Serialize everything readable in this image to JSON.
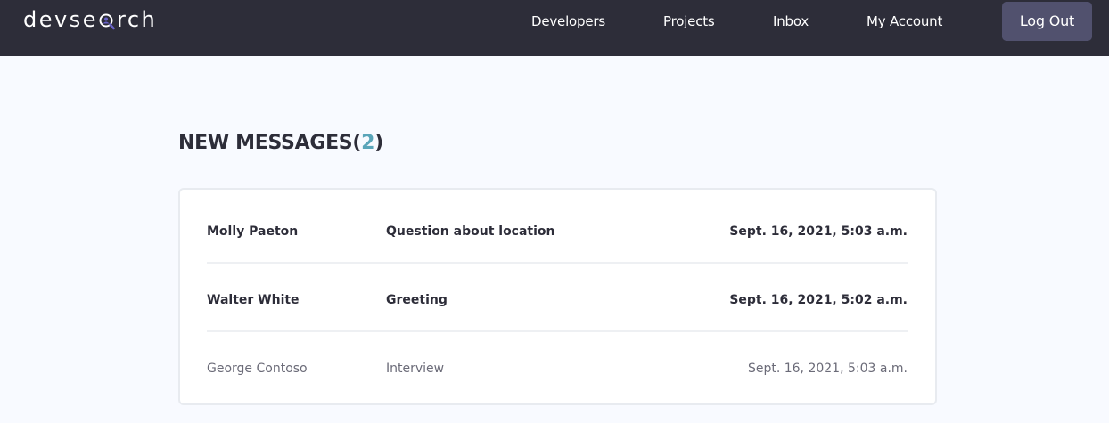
{
  "app": {
    "logo_prefix": "devse",
    "logo_suffix": "rch",
    "logo_icon": "magnifier-person-icon"
  },
  "nav": {
    "developers": "Developers",
    "projects": "Projects",
    "inbox": "Inbox",
    "account": "My Account",
    "logout": "Log Out"
  },
  "page": {
    "heading_text": "NEW MESSAGES(",
    "unread_count": "2",
    "heading_close": ")"
  },
  "messages": [
    {
      "sender": "Molly Paeton",
      "subject": "Question about location",
      "date": "Sept. 16, 2021, 5:03 a.m.",
      "unread": true
    },
    {
      "sender": "Walter White",
      "subject": "Greeting",
      "date": "Sept. 16, 2021, 5:02 a.m.",
      "unread": true
    },
    {
      "sender": "George Contoso",
      "subject": "Interview",
      "date": "Sept. 16, 2021, 5:03 a.m.",
      "unread": false
    }
  ],
  "colors": {
    "header_bg": "#2d2d39",
    "page_bg": "#f8faff",
    "accent": "#5aa5b9",
    "button_bg": "#51516e"
  }
}
